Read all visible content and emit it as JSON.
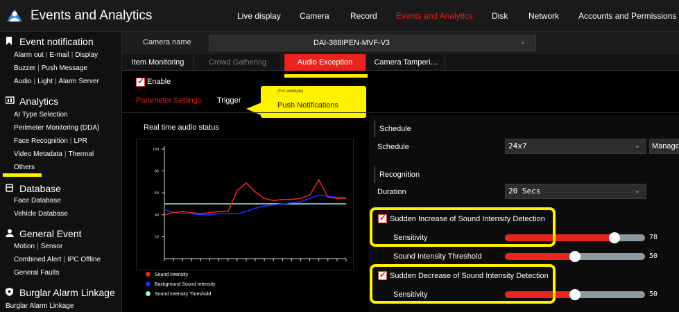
{
  "header": {
    "app_title": "Events and Analytics",
    "nav": [
      {
        "label": "Live display"
      },
      {
        "label": "Camera"
      },
      {
        "label": "Record"
      },
      {
        "label": "Events and Analytics",
        "active": true
      },
      {
        "label": "Disk"
      },
      {
        "label": "Network"
      },
      {
        "label": "Accounts and Permissions"
      }
    ]
  },
  "sidebar": {
    "sections": [
      {
        "title": "Event notification",
        "icon": "bookmark-icon",
        "lines": [
          [
            "Alarm out",
            "E-mail",
            "Display"
          ],
          [
            "Buzzer",
            "Push Message"
          ],
          [
            "Audio",
            "Light",
            "Alarm Server"
          ]
        ]
      },
      {
        "title": "Analytics",
        "icon": "analytics-icon",
        "lines": [
          [
            "AI Type Selection"
          ],
          [
            "Perimeter Monitoring (DDA)"
          ],
          [
            "Face Recognition",
            "LPR"
          ],
          [
            "Video Metadata",
            "Thermal"
          ],
          [
            "Others"
          ]
        ]
      },
      {
        "title": "Database",
        "icon": "database-icon",
        "lines": [
          [
            "Face Database"
          ],
          [
            "Vehicle Database"
          ]
        ]
      },
      {
        "title": "General Event",
        "icon": "person-icon",
        "lines": [
          [
            "Motion",
            "Sensor"
          ],
          [
            "Combined Alert",
            "IPC Offline"
          ],
          [
            "General Faults"
          ]
        ]
      },
      {
        "title": "Burglar Alarm Linkage",
        "icon": "shield-icon",
        "lines": [
          [
            "Burglar Alarm Linkage"
          ]
        ]
      }
    ]
  },
  "camera": {
    "label": "Camera name",
    "value": "DAI-388IPEN-MVF-V3"
  },
  "tabs": [
    {
      "label": "Item Monitoring"
    },
    {
      "label": "Crowd Gathering"
    },
    {
      "label": "Audio Exception"
    },
    {
      "label": "Camera Tamperi…"
    }
  ],
  "enable_label": "Enable",
  "subtabs": [
    {
      "label": "Parameter Settings"
    },
    {
      "label": "Trigger"
    }
  ],
  "callout": {
    "small": "(For example)",
    "text": "Push Notifications"
  },
  "audio_status": {
    "title": "Real time audio status"
  },
  "legend": [
    {
      "label": "Sound Intensity",
      "color": "#e8241c"
    },
    {
      "label": "Background Sound Intensity",
      "color": "#1e2bff"
    },
    {
      "label": "Sound Intensity Threshold",
      "color": "#8ff5ee"
    }
  ],
  "chart_data": {
    "type": "line",
    "ylim": [
      0,
      100
    ],
    "yticks": [
      "100",
      "80",
      "60",
      "40",
      "20"
    ],
    "x": [
      0,
      1,
      2,
      3,
      4,
      5,
      6,
      7,
      8,
      9,
      10,
      11,
      12,
      13,
      14,
      15,
      16,
      17,
      18,
      19,
      20
    ],
    "series": [
      {
        "name": "Sound Intensity",
        "color": "#e8241c",
        "values": [
          40,
          42,
          43,
          42,
          41,
          42,
          43,
          43,
          62,
          69,
          61,
          55,
          53,
          54,
          54,
          55,
          58,
          72,
          56,
          55,
          55
        ]
      },
      {
        "name": "Background Sound Intensity",
        "color": "#1e2bff",
        "values": [
          45,
          42,
          41,
          41,
          40,
          40,
          41,
          41,
          41,
          43,
          46,
          48,
          49,
          50,
          51,
          52,
          55,
          58,
          57,
          56,
          56
        ]
      },
      {
        "name": "Sound Intensity Threshold",
        "color": "#8ff5ee",
        "values": [
          50,
          50,
          50,
          50,
          50,
          50,
          50,
          50,
          50,
          50,
          50,
          50,
          50,
          50,
          50,
          50,
          50,
          50,
          50,
          50,
          50
        ]
      }
    ]
  },
  "settings": {
    "schedule_group": "Schedule",
    "schedule_label": "Schedule",
    "schedule_value": "24x7",
    "manage_label": "Manage",
    "recognition_group": "Recognition",
    "duration_label": "Duration",
    "duration_value": "20 Secs",
    "increase_label": "Sudden Increase of Sound Intensity Detection",
    "increase_sensitivity_label": "Sensitivity",
    "increase_sensitivity_value": "78",
    "increase_sensitivity_level": 0.78,
    "threshold_label": "Sound Intensity Threshold",
    "threshold_value": "50",
    "threshold_level": 0.5,
    "decrease_label": "Sudden Decrease of Sound Intensity Detection",
    "decrease_sensitivity_label": "Sensitivity",
    "decrease_sensitivity_value": "50",
    "decrease_sensitivity_level": 0.5
  },
  "colors": {
    "accent": "#e8241c",
    "highlight": "#ffef00",
    "slider_track": "#8a9aa0"
  }
}
